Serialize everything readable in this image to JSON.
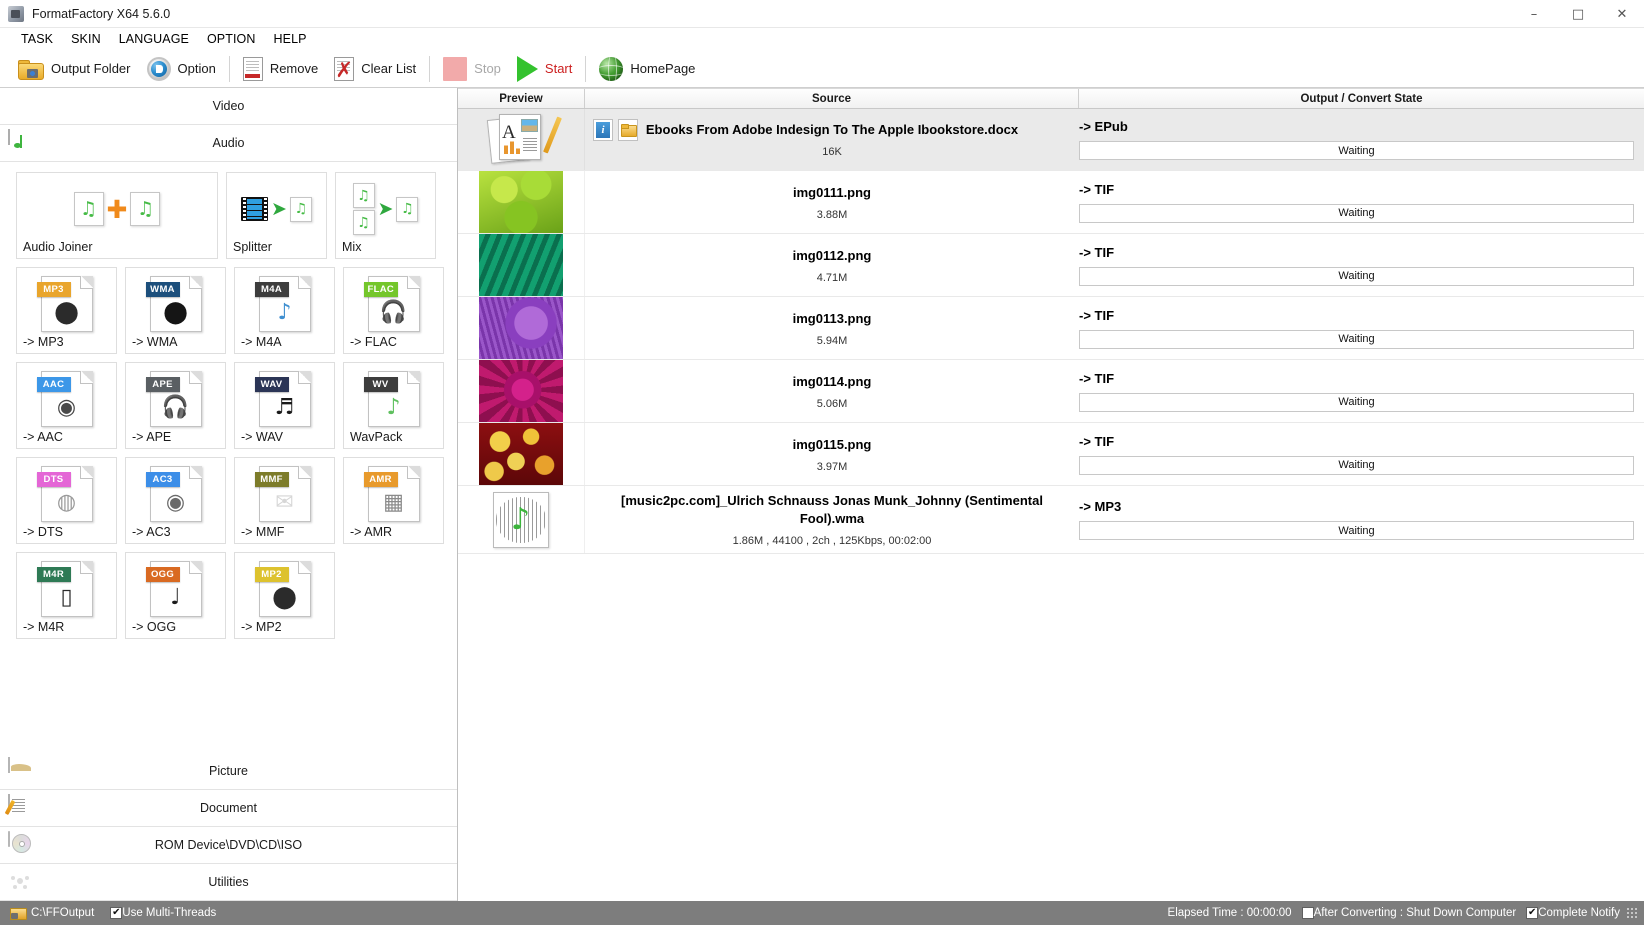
{
  "window": {
    "title": "FormatFactory X64 5.6.0",
    "minimize": "–",
    "maximize": "□",
    "close": "✕"
  },
  "menubar": {
    "items": [
      {
        "label": "TASK"
      },
      {
        "label": "SKIN"
      },
      {
        "label": "LANGUAGE"
      },
      {
        "label": "OPTION"
      },
      {
        "label": "HELP"
      }
    ]
  },
  "toolbar": {
    "output_folder": "Output Folder",
    "option": "Option",
    "remove": "Remove",
    "clear_list": "Clear List",
    "stop": "Stop",
    "start": "Start",
    "homepage": "HomePage"
  },
  "sidebar": {
    "top_categories": [
      {
        "label": "Video",
        "icon": "film-icon"
      },
      {
        "label": "Audio",
        "icon": "audio-note-icon"
      }
    ],
    "bottom_categories": [
      {
        "label": "Picture",
        "icon": "picture-icon"
      },
      {
        "label": "Document",
        "icon": "document-icon"
      },
      {
        "label": "ROM Device\\DVD\\CD\\ISO",
        "icon": "disc-icon"
      },
      {
        "label": "Utilities",
        "icon": "reel-icon"
      }
    ],
    "tools": [
      {
        "label": "Audio Joiner",
        "icon": "audio-joiner-icon",
        "wide": true
      },
      {
        "label": "Splitter",
        "icon": "splitter-icon",
        "wide": false
      },
      {
        "label": "Mix",
        "icon": "mix-icon",
        "wide": false
      }
    ],
    "formats": [
      {
        "label": "-> MP3",
        "badge": "MP3",
        "badge_color": "#e9a52c",
        "glyph": "⬤",
        "glyph_color": "#2b2b2b"
      },
      {
        "label": "-> WMA",
        "badge": "WMA",
        "badge_color": "#1c4f7c",
        "glyph": "⬤",
        "glyph_color": "#151515"
      },
      {
        "label": "-> M4A",
        "badge": "M4A",
        "badge_color": "#3d3d3d",
        "glyph": "♪",
        "glyph_color": "#3f8fd0"
      },
      {
        "label": "-> FLAC",
        "badge": "FLAC",
        "badge_color": "#74c62b",
        "glyph": "🎧",
        "glyph_color": "#2b2b2b"
      },
      {
        "label": "-> AAC",
        "badge": "AAC",
        "badge_color": "#3c97e8",
        "glyph": "◉",
        "glyph_color": "#4a4a4a"
      },
      {
        "label": "-> APE",
        "badge": "APE",
        "badge_color": "#5a5f63",
        "glyph": "🎧",
        "glyph_color": "#8a9aa5"
      },
      {
        "label": "-> WAV",
        "badge": "WAV",
        "badge_color": "#2b3556",
        "glyph": "♬",
        "glyph_color": "#1a1a1a"
      },
      {
        "label": "WavPack",
        "badge": "WV",
        "badge_color": "#3d3d3d",
        "glyph": "♪",
        "glyph_color": "#5fc05f"
      },
      {
        "label": "-> DTS",
        "badge": "DTS",
        "badge_color": "#e466d6",
        "glyph": "◍",
        "glyph_color": "#9a9a9a"
      },
      {
        "label": "-> AC3",
        "badge": "AC3",
        "badge_color": "#3c8ee8",
        "glyph": "◉",
        "glyph_color": "#6a6a6a"
      },
      {
        "label": "-> MMF",
        "badge": "MMF",
        "badge_color": "#7d7c2a",
        "glyph": "✉",
        "glyph_color": "#d6d6d6"
      },
      {
        "label": "-> AMR",
        "badge": "AMR",
        "badge_color": "#e89a2c",
        "glyph": "▦",
        "glyph_color": "#8a8a8a"
      },
      {
        "label": "-> M4R",
        "badge": "M4R",
        "badge_color": "#2e7a55",
        "glyph": "▯",
        "glyph_color": "#2b2b2b"
      },
      {
        "label": "-> OGG",
        "badge": "OGG",
        "badge_color": "#d96a22",
        "glyph": "♩",
        "glyph_color": "#1a1a1a"
      },
      {
        "label": "-> MP2",
        "badge": "MP2",
        "badge_color": "#ddc22e",
        "glyph": "⬤",
        "glyph_color": "#2b2b2b"
      }
    ]
  },
  "list": {
    "columns": {
      "preview": "Preview",
      "source": "Source",
      "output": "Output / Convert State"
    },
    "rows": [
      {
        "name": "Ebooks From Adobe Indesign To The Apple Ibookstore.docx",
        "meta": "16K",
        "output": "-> EPub",
        "state": "Waiting",
        "preview": "document-thumb",
        "selected": true,
        "has_buttons": true,
        "info_button": "i",
        "folder_button": "folder-icon"
      },
      {
        "name": "img0111.png",
        "meta": "3.88M",
        "output": "-> TIF",
        "state": "Waiting",
        "preview": "image-thumb-green",
        "selected": false,
        "has_buttons": false
      },
      {
        "name": "img0112.png",
        "meta": "4.71M",
        "output": "-> TIF",
        "state": "Waiting",
        "preview": "image-thumb-teal",
        "selected": false,
        "has_buttons": false
      },
      {
        "name": "img0113.png",
        "meta": "5.94M",
        "output": "-> TIF",
        "state": "Waiting",
        "preview": "image-thumb-purple",
        "selected": false,
        "has_buttons": false
      },
      {
        "name": "img0114.png",
        "meta": "5.06M",
        "output": "-> TIF",
        "state": "Waiting",
        "preview": "image-thumb-magenta",
        "selected": false,
        "has_buttons": false
      },
      {
        "name": "img0115.png",
        "meta": "3.97M",
        "output": "-> TIF",
        "state": "Waiting",
        "preview": "image-thumb-red",
        "selected": false,
        "has_buttons": false
      },
      {
        "name": "[music2pc.com]_Ulrich Schnauss Jonas Munk_Johnny (Sentimental Fool).wma",
        "meta": "1.86M , 44100 , 2ch , 125Kbps, 00:02:00",
        "output": "-> MP3",
        "state": "Waiting",
        "preview": "audio-thumb",
        "selected": false,
        "has_buttons": false
      }
    ]
  },
  "statusbar": {
    "output_path": "C:\\FFOutput",
    "multithreads_label": "Use Multi-Threads",
    "multithreads_checked": "✔",
    "elapsed": "Elapsed Time : 00:00:00",
    "shutdown_label": "After Converting : Shut Down Computer",
    "shutdown_checked": "",
    "notify_label": "Complete Notify",
    "notify_checked": "✔"
  }
}
